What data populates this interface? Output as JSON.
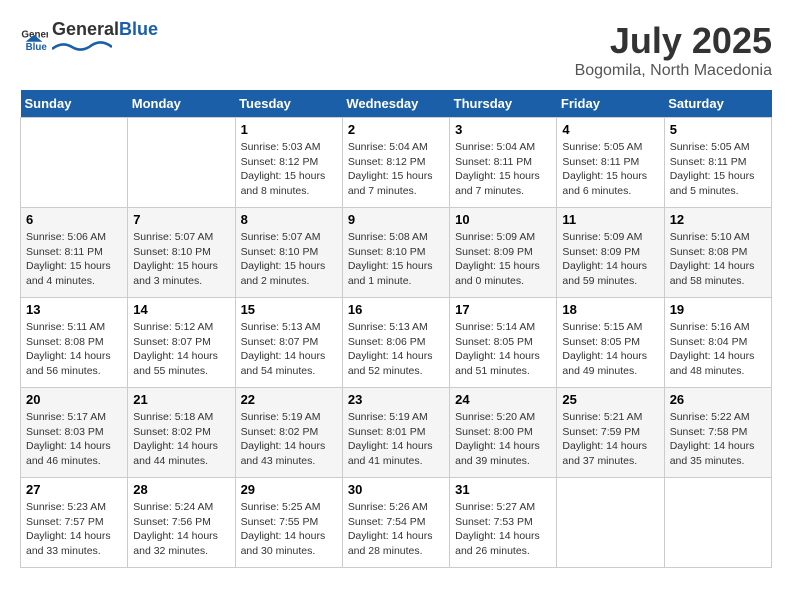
{
  "header": {
    "logo_general": "General",
    "logo_blue": "Blue",
    "month": "July 2025",
    "location": "Bogomila, North Macedonia"
  },
  "days_of_week": [
    "Sunday",
    "Monday",
    "Tuesday",
    "Wednesday",
    "Thursday",
    "Friday",
    "Saturday"
  ],
  "weeks": [
    [
      {
        "day": "",
        "info": ""
      },
      {
        "day": "",
        "info": ""
      },
      {
        "day": "1",
        "info": "Sunrise: 5:03 AM\nSunset: 8:12 PM\nDaylight: 15 hours and 8 minutes."
      },
      {
        "day": "2",
        "info": "Sunrise: 5:04 AM\nSunset: 8:12 PM\nDaylight: 15 hours and 7 minutes."
      },
      {
        "day": "3",
        "info": "Sunrise: 5:04 AM\nSunset: 8:11 PM\nDaylight: 15 hours and 7 minutes."
      },
      {
        "day": "4",
        "info": "Sunrise: 5:05 AM\nSunset: 8:11 PM\nDaylight: 15 hours and 6 minutes."
      },
      {
        "day": "5",
        "info": "Sunrise: 5:05 AM\nSunset: 8:11 PM\nDaylight: 15 hours and 5 minutes."
      }
    ],
    [
      {
        "day": "6",
        "info": "Sunrise: 5:06 AM\nSunset: 8:11 PM\nDaylight: 15 hours and 4 minutes."
      },
      {
        "day": "7",
        "info": "Sunrise: 5:07 AM\nSunset: 8:10 PM\nDaylight: 15 hours and 3 minutes."
      },
      {
        "day": "8",
        "info": "Sunrise: 5:07 AM\nSunset: 8:10 PM\nDaylight: 15 hours and 2 minutes."
      },
      {
        "day": "9",
        "info": "Sunrise: 5:08 AM\nSunset: 8:10 PM\nDaylight: 15 hours and 1 minute."
      },
      {
        "day": "10",
        "info": "Sunrise: 5:09 AM\nSunset: 8:09 PM\nDaylight: 15 hours and 0 minutes."
      },
      {
        "day": "11",
        "info": "Sunrise: 5:09 AM\nSunset: 8:09 PM\nDaylight: 14 hours and 59 minutes."
      },
      {
        "day": "12",
        "info": "Sunrise: 5:10 AM\nSunset: 8:08 PM\nDaylight: 14 hours and 58 minutes."
      }
    ],
    [
      {
        "day": "13",
        "info": "Sunrise: 5:11 AM\nSunset: 8:08 PM\nDaylight: 14 hours and 56 minutes."
      },
      {
        "day": "14",
        "info": "Sunrise: 5:12 AM\nSunset: 8:07 PM\nDaylight: 14 hours and 55 minutes."
      },
      {
        "day": "15",
        "info": "Sunrise: 5:13 AM\nSunset: 8:07 PM\nDaylight: 14 hours and 54 minutes."
      },
      {
        "day": "16",
        "info": "Sunrise: 5:13 AM\nSunset: 8:06 PM\nDaylight: 14 hours and 52 minutes."
      },
      {
        "day": "17",
        "info": "Sunrise: 5:14 AM\nSunset: 8:05 PM\nDaylight: 14 hours and 51 minutes."
      },
      {
        "day": "18",
        "info": "Sunrise: 5:15 AM\nSunset: 8:05 PM\nDaylight: 14 hours and 49 minutes."
      },
      {
        "day": "19",
        "info": "Sunrise: 5:16 AM\nSunset: 8:04 PM\nDaylight: 14 hours and 48 minutes."
      }
    ],
    [
      {
        "day": "20",
        "info": "Sunrise: 5:17 AM\nSunset: 8:03 PM\nDaylight: 14 hours and 46 minutes."
      },
      {
        "day": "21",
        "info": "Sunrise: 5:18 AM\nSunset: 8:02 PM\nDaylight: 14 hours and 44 minutes."
      },
      {
        "day": "22",
        "info": "Sunrise: 5:19 AM\nSunset: 8:02 PM\nDaylight: 14 hours and 43 minutes."
      },
      {
        "day": "23",
        "info": "Sunrise: 5:19 AM\nSunset: 8:01 PM\nDaylight: 14 hours and 41 minutes."
      },
      {
        "day": "24",
        "info": "Sunrise: 5:20 AM\nSunset: 8:00 PM\nDaylight: 14 hours and 39 minutes."
      },
      {
        "day": "25",
        "info": "Sunrise: 5:21 AM\nSunset: 7:59 PM\nDaylight: 14 hours and 37 minutes."
      },
      {
        "day": "26",
        "info": "Sunrise: 5:22 AM\nSunset: 7:58 PM\nDaylight: 14 hours and 35 minutes."
      }
    ],
    [
      {
        "day": "27",
        "info": "Sunrise: 5:23 AM\nSunset: 7:57 PM\nDaylight: 14 hours and 33 minutes."
      },
      {
        "day": "28",
        "info": "Sunrise: 5:24 AM\nSunset: 7:56 PM\nDaylight: 14 hours and 32 minutes."
      },
      {
        "day": "29",
        "info": "Sunrise: 5:25 AM\nSunset: 7:55 PM\nDaylight: 14 hours and 30 minutes."
      },
      {
        "day": "30",
        "info": "Sunrise: 5:26 AM\nSunset: 7:54 PM\nDaylight: 14 hours and 28 minutes."
      },
      {
        "day": "31",
        "info": "Sunrise: 5:27 AM\nSunset: 7:53 PM\nDaylight: 14 hours and 26 minutes."
      },
      {
        "day": "",
        "info": ""
      },
      {
        "day": "",
        "info": ""
      }
    ]
  ]
}
